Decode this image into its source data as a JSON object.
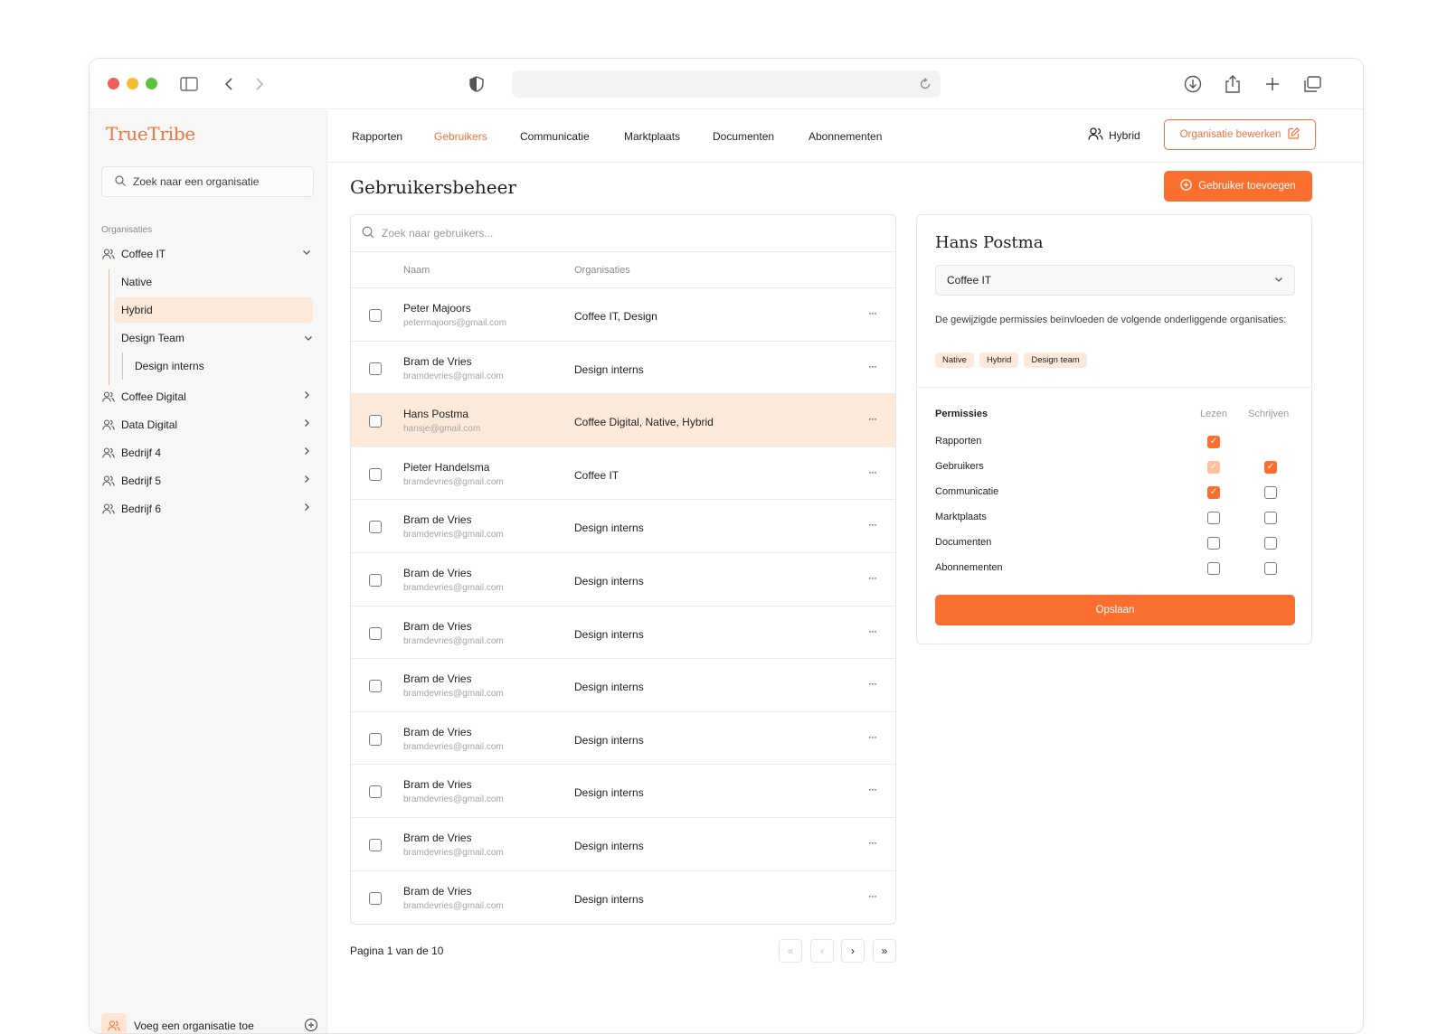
{
  "brand": "TrueTribe",
  "sidebar": {
    "search_placeholder": "Zoek naar een organisatie",
    "section_label": "Organisaties",
    "orgs": [
      {
        "label": "Coffee IT",
        "expanded": true
      },
      {
        "label": "Coffee Digital"
      },
      {
        "label": "Data Digital"
      },
      {
        "label": "Bedrijf 4"
      },
      {
        "label": "Bedrijf 5"
      },
      {
        "label": "Bedrijf 6"
      }
    ],
    "sub_items": [
      "Native",
      "Hybrid",
      "Design Team",
      "Design interns"
    ],
    "active_sub": "Hybrid",
    "footer_label": "Voeg een organisatie toe"
  },
  "nav": {
    "tabs": [
      "Rapporten",
      "Gebruikers",
      "Communicatie",
      "Marktplaats",
      "Documenten",
      "Abonnementen"
    ],
    "active_tab": "Gebruikers",
    "current_org": "Hybrid",
    "edit_org_label": "Organisatie bewerken"
  },
  "page": {
    "title": "Gebruikersbeheer",
    "add_user_label": "Gebruiker toevoegen"
  },
  "table": {
    "search_placeholder": "Zoek naar gebruikers...",
    "columns": [
      "Naam",
      "Organisaties"
    ],
    "rows": [
      {
        "name": "Peter Majoors",
        "email": "petermajoors@gmail.com",
        "orgs": "Coffee IT, Design",
        "more": "···"
      },
      {
        "name": "Bram de Vries",
        "email": "bramdevries@gmail.com",
        "orgs": "Design interns",
        "more": "···"
      },
      {
        "name": "Hans Postma",
        "email": "hansje@gmail.com",
        "orgs": "Coffee Digital, Native, Hybrid",
        "more": "···",
        "selected": true
      },
      {
        "name": "Pieter Handelsma",
        "email": "bramdevries@gmail.com",
        "orgs": "Coffee IT",
        "more": "···"
      },
      {
        "name": "Bram de Vries",
        "email": "bramdevries@gmail.com",
        "orgs": "Design interns",
        "more": "···"
      },
      {
        "name": "Bram de Vries",
        "email": "bramdevries@gmail.com",
        "orgs": "Design interns",
        "more": "···"
      },
      {
        "name": "Bram de Vries",
        "email": "bramdevries@gmail.com",
        "orgs": "Design interns",
        "more": "···"
      },
      {
        "name": "Bram de Vries",
        "email": "bramdevries@gmail.com",
        "orgs": "Design interns",
        "more": "···"
      },
      {
        "name": "Bram de Vries",
        "email": "bramdevries@gmail.com",
        "orgs": "Design interns",
        "more": "···"
      },
      {
        "name": "Bram de Vries",
        "email": "bramdevries@gmail.com",
        "orgs": "Design interns",
        "more": "···"
      },
      {
        "name": "Bram de Vries",
        "email": "bramdevries@gmail.com",
        "orgs": "Design interns",
        "more": "···"
      },
      {
        "name": "Bram de Vries",
        "email": "bramdevries@gmail.com",
        "orgs": "Design interns",
        "more": "···"
      }
    ]
  },
  "pagination": {
    "text": "Pagina 1 van de 10",
    "first": "«",
    "prev": "‹",
    "next": "›",
    "last": "»"
  },
  "detail": {
    "name": "Hans Postma",
    "selected_org": "Coffee IT",
    "note": "De gewijzigde permissies beïnvloeden de volgende onderliggende organisaties:",
    "tags": [
      "Native",
      "Hybrid",
      "Design team"
    ],
    "perm_header": "Permissies",
    "col_read": "Lezen",
    "col_write": "Schrijven",
    "permissions": [
      {
        "label": "Rapporten",
        "read": "on",
        "write": "none"
      },
      {
        "label": "Gebruikers",
        "read": "faded",
        "write": "on"
      },
      {
        "label": "Communicatie",
        "read": "on",
        "write": "off"
      },
      {
        "label": "Marktplaats",
        "read": "off",
        "write": "off"
      },
      {
        "label": "Documenten",
        "read": "off",
        "write": "off"
      },
      {
        "label": "Abonnementen",
        "read": "off",
        "write": "off"
      }
    ],
    "save_label": "Opslaan"
  },
  "colors": {
    "accent": "#fa6e2e",
    "accent_soft": "#fde9d9",
    "brand_text": "#f0733a"
  }
}
